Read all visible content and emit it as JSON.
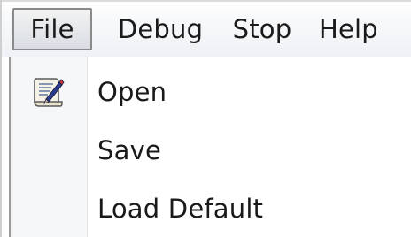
{
  "menubar": {
    "items": [
      {
        "label": "File",
        "active": true
      },
      {
        "label": "Debug",
        "active": false
      },
      {
        "label": "Stop",
        "active": false
      },
      {
        "label": "Help",
        "active": false
      }
    ]
  },
  "file_menu": {
    "items": [
      {
        "label": "Open",
        "icon": "open-document-icon"
      },
      {
        "label": "Save"
      },
      {
        "label": "Load Default"
      }
    ]
  },
  "colors": {
    "active_border": "#8a8a8a",
    "text": "#1a1a1a",
    "icon_strip": "#f6f7f9"
  }
}
